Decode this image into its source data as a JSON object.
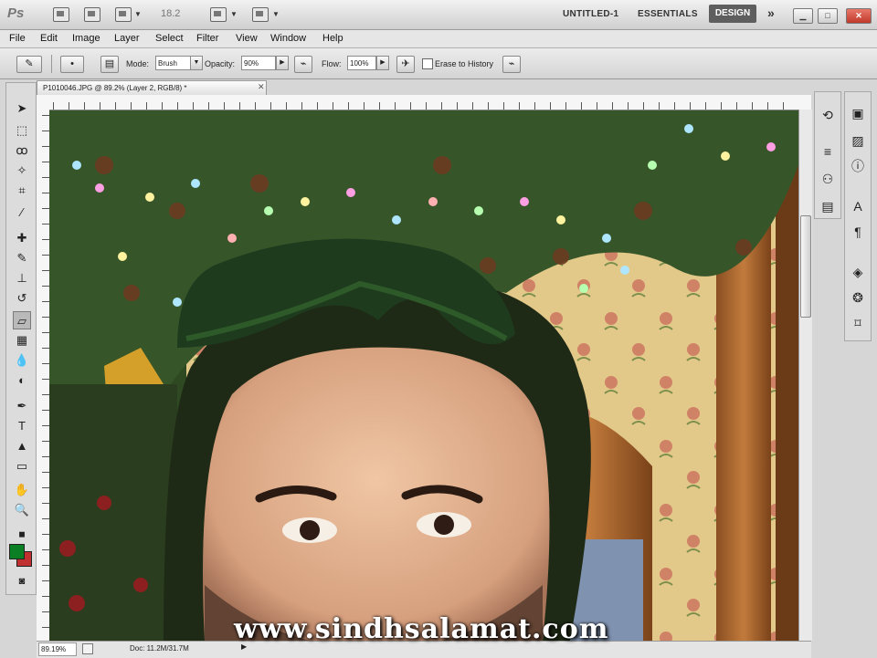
{
  "app": {
    "logo": "Ps",
    "zoom": "18.2",
    "workspaces": [
      "UNTITLED-1",
      "ESSENTIALS"
    ],
    "active_workspace": "DESIGN",
    "more": "»"
  },
  "menu": [
    "File",
    "Edit",
    "Image",
    "Layer",
    "Select",
    "Filter",
    "View",
    "Window",
    "Help"
  ],
  "options": {
    "mode_label": "Mode:",
    "mode_value": "Brush",
    "opacity_label": "Opacity:",
    "opacity_value": "90%",
    "flow_label": "Flow:",
    "flow_value": "100%",
    "erase_history_label": "Erase to History"
  },
  "document": {
    "tab_title": "P1010046.JPG @ 89.2% (Layer 2, RGB/8) *",
    "zoom_status": "89.19%",
    "doc_info": "Doc: 11.2M/31.7M"
  },
  "colors": {
    "foreground": "#0a7f24",
    "background": "#c03030",
    "active_workspace_bg": "#5e5e5e"
  },
  "tools": [
    "move-icon",
    "marquee-icon",
    "lasso-icon",
    "quick-select-icon",
    "crop-icon",
    "eyedropper-icon",
    "spot-heal-icon",
    "brush-icon",
    "clone-stamp-icon",
    "history-brush-icon",
    "eraser-icon",
    "gradient-icon",
    "blur-icon",
    "dodge-icon",
    "pen-icon",
    "type-icon",
    "path-select-icon",
    "shape-icon",
    "hand-icon",
    "zoom-icon"
  ],
  "watermark": "www.sindhsalamat.com"
}
